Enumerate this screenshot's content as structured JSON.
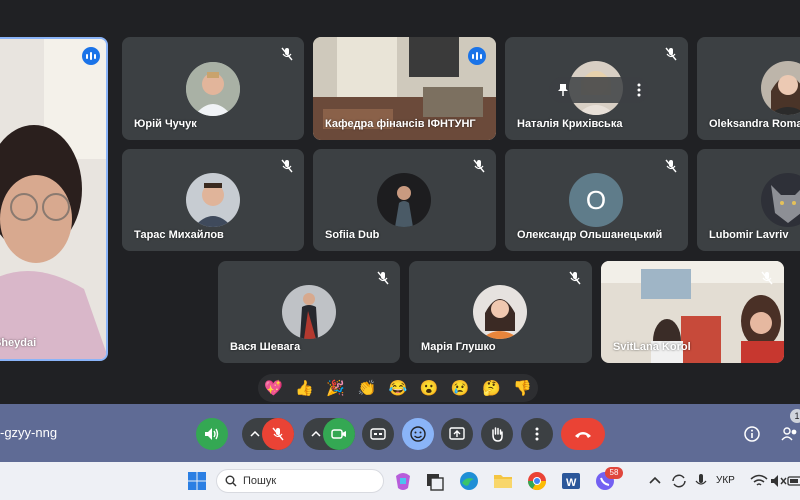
{
  "participants": {
    "self_partial_name": "Sheydai",
    "yuriy": "Юрій Чучук",
    "kafedra": "Кафедра фінансів ІФНТУНГ",
    "natalia": "Наталія Крихівська",
    "oleksandra": "Oleksandra Romas",
    "taras": "Тарас Михайлов",
    "sofiia": "Sofiia Dub",
    "oleksandr": "Олександр Ольшанецький",
    "oleksandr_initial": "О",
    "lubomir": "Lubomir Lavriv",
    "vasia": "Вася Шевага",
    "maria": "Марія Глушко",
    "svitlana": "SvitLana Korol"
  },
  "reactions": [
    "💖",
    "👍",
    "🎉",
    "👏",
    "😂",
    "😮",
    "😢",
    "🤔",
    "👎"
  ],
  "controls": {
    "meeting_code": "-gzyy-nng",
    "people_count": "1"
  },
  "taskbar": {
    "search_placeholder": "Пошук",
    "language": "УКР",
    "mail_badge": "58"
  },
  "colors": {
    "tile": "#3c4043",
    "control_bar": "#5f6b95",
    "green_button": "#34a853",
    "red_button": "#ea4335",
    "accent_blue": "#1a73e8",
    "active_button": "#8ab4f8"
  }
}
